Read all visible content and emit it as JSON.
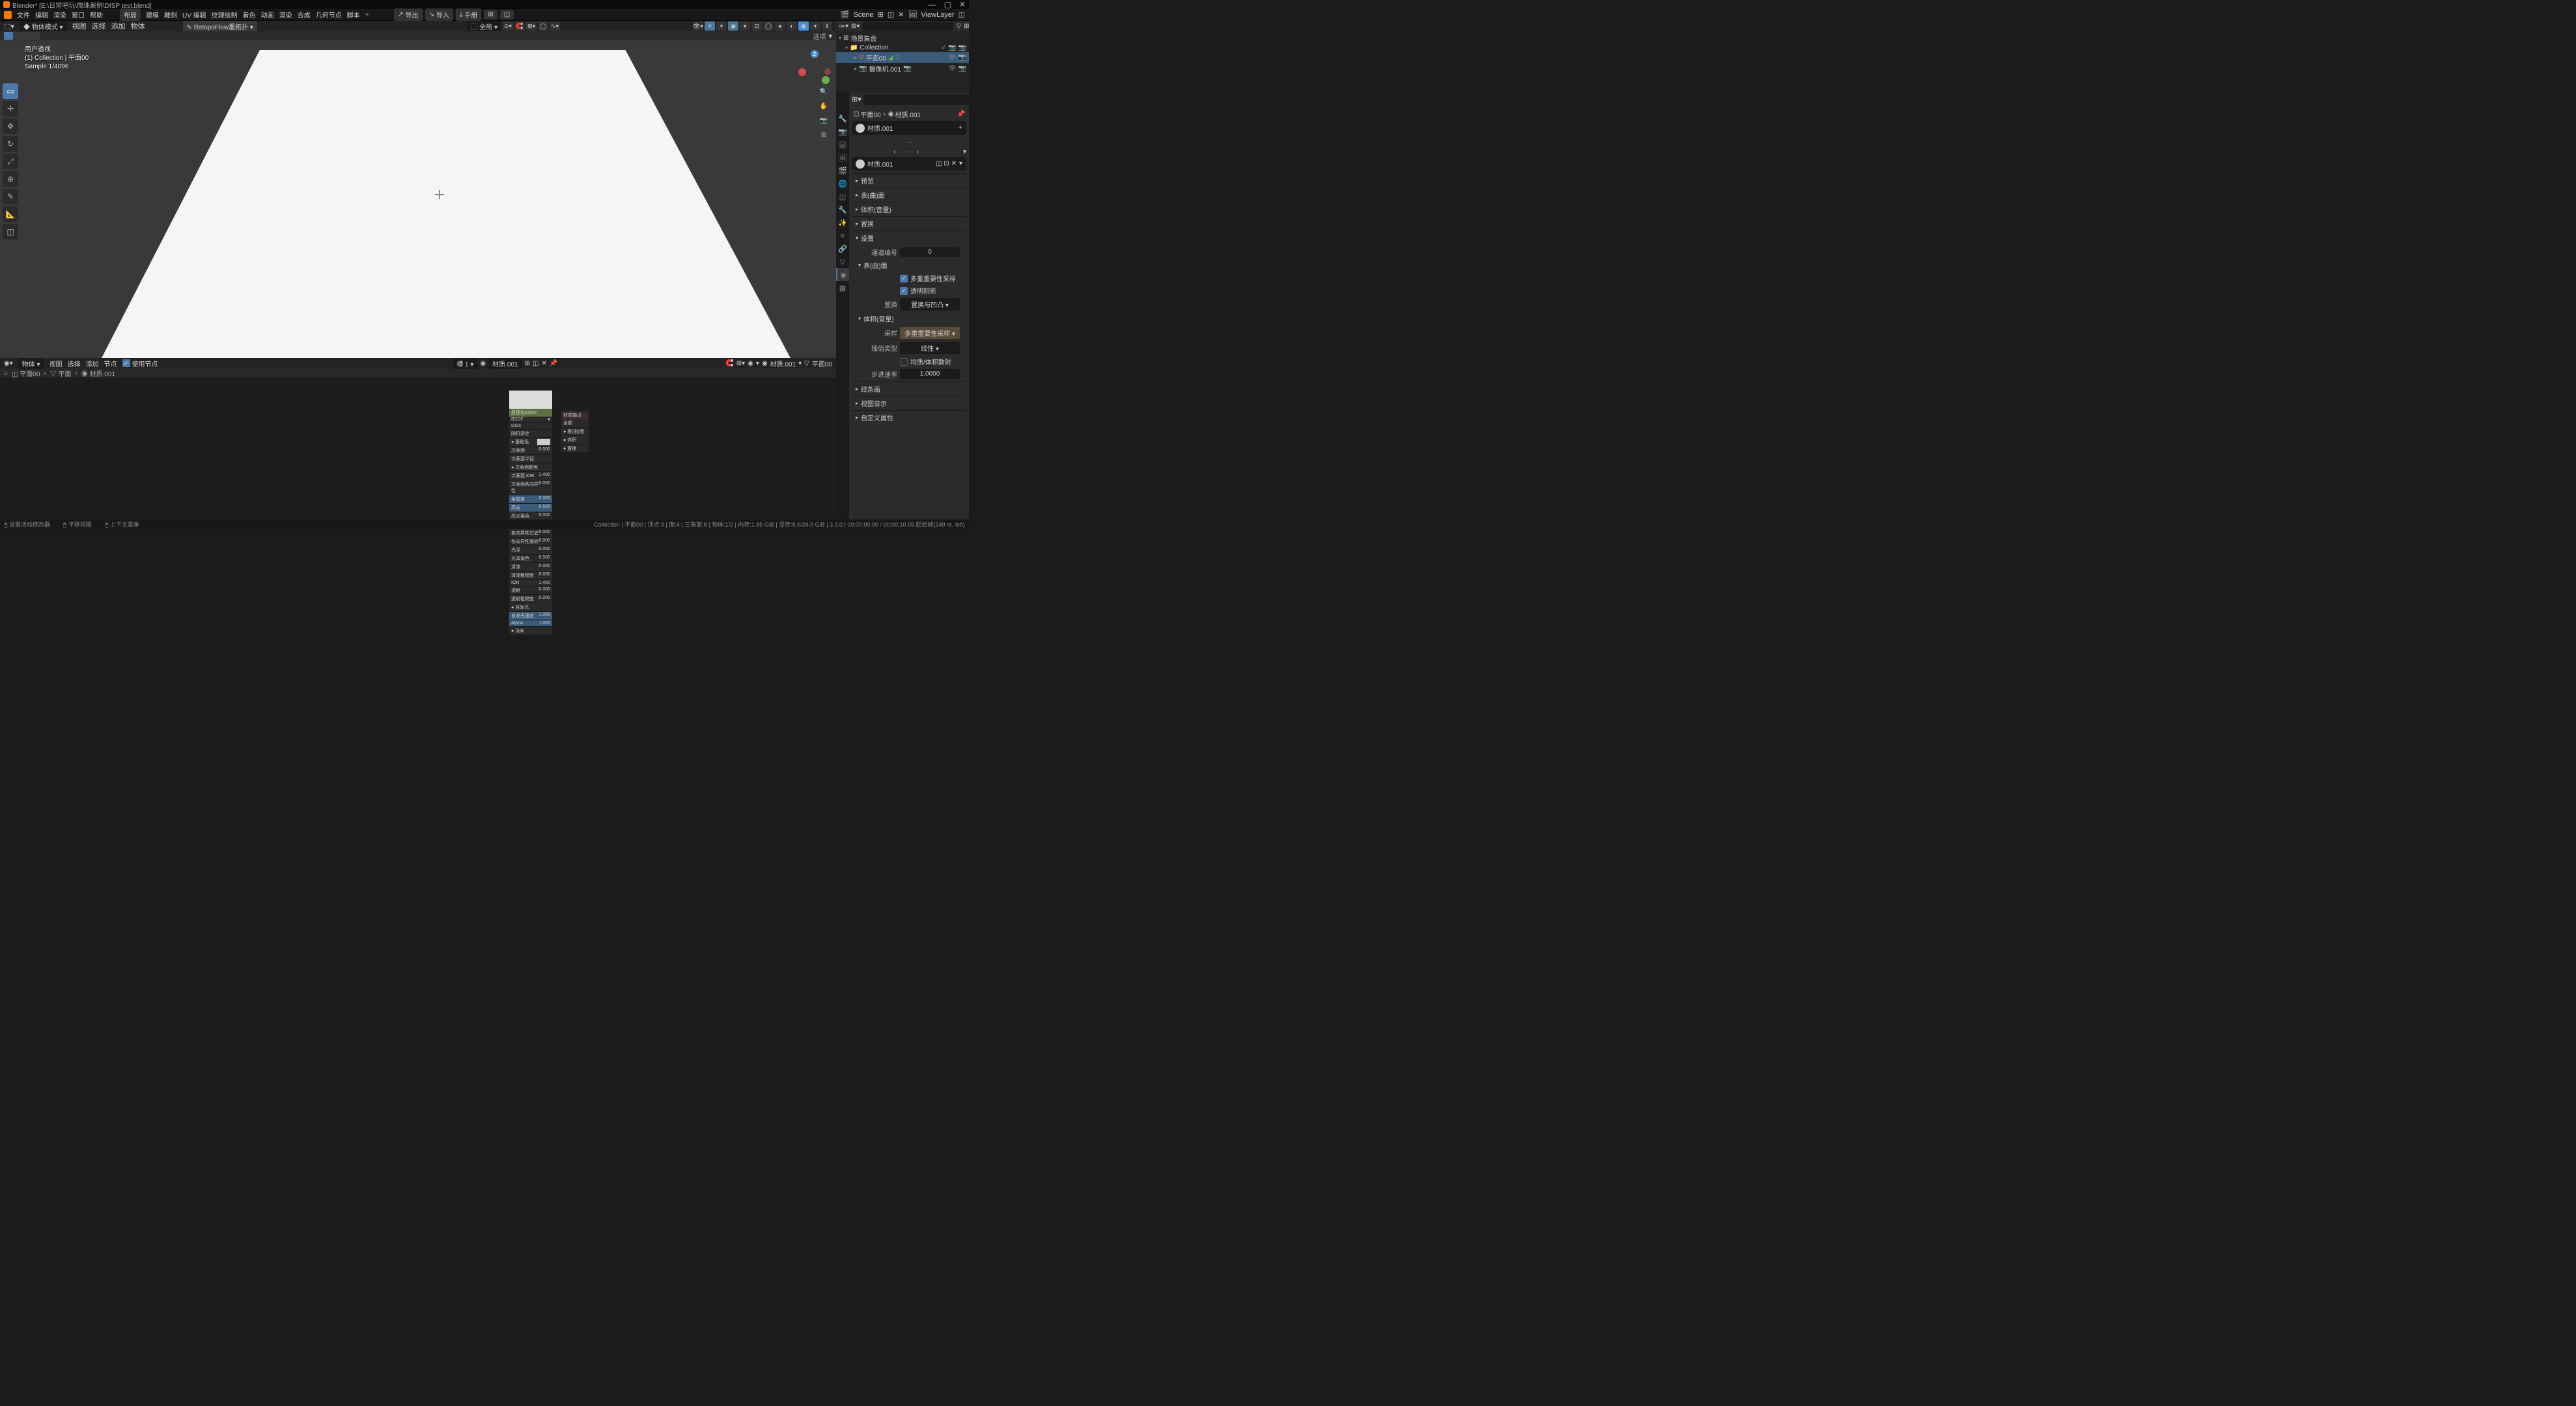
{
  "titlebar": {
    "title": "Blender* [E:\\日常吧玩\\微珠案例\\DISP test.blend]"
  },
  "menubar": {
    "items": [
      "文件",
      "编辑",
      "渲染",
      "窗口",
      "帮助"
    ],
    "tabs": [
      "布局",
      "建模",
      "雕刻",
      "UV 编辑",
      "纹理绘制",
      "着色",
      "动画",
      "渲染",
      "合成",
      "几何节点",
      "脚本"
    ],
    "active_tab": "布局",
    "center": {
      "export": "导出",
      "import": "导入",
      "manual": "手册"
    },
    "scene_label": "Scene",
    "viewlayer_label": "ViewLayer"
  },
  "toolbar2": {
    "mode": "物体模式",
    "menu": [
      "视图",
      "选择",
      "添加",
      "物体"
    ],
    "retopo": "RetopoFlow重拓扑",
    "global": "全局"
  },
  "toolbar3": {
    "options": "选项"
  },
  "viewport": {
    "info_line1": "用户透视",
    "info_line2": "(1) Collection | 平面00",
    "info_line3": "Sample 1/4096"
  },
  "outliner": {
    "header": "场景集合",
    "search_placeholder": "",
    "tree": [
      {
        "label": "Collection",
        "indent": 0,
        "icons": [
          "✓",
          "📷",
          "📷"
        ]
      },
      {
        "label": "平面00",
        "indent": 1,
        "selected": true,
        "icons": [
          "👁",
          "📷"
        ]
      },
      {
        "label": "摄像机.001",
        "indent": 1,
        "icons": [
          "👁",
          "📷"
        ]
      }
    ]
  },
  "properties": {
    "search_placeholder": "",
    "breadcrumb": {
      "obj": "平面00",
      "mat": "材质.001"
    },
    "material_name": "材质.001",
    "linked_mat": "材质.001",
    "sections": {
      "preview": "预览",
      "surface": "表(曲)面",
      "volume": "体积(音量)",
      "displacement": "置换",
      "settings": "设置",
      "pass_index_label": "通道编号",
      "pass_index_value": "0",
      "sub_surface": "表(曲)面",
      "multi_importance": "多重重要性采样",
      "transparent_shadows": "透明阴影",
      "displacement_label": "置换",
      "displacement_value": "置换与凹凸",
      "sub_volume": "体积(音量)",
      "sampling_label": "采样",
      "sampling_value": "多重重要性采样",
      "interp_label": "插值类型",
      "interp_value": "线性",
      "homogeneous": "均质/体积散射",
      "step_label": "步进速率",
      "step_value": "1.0000",
      "line_art": "线条画",
      "viewport_display": "视图显示",
      "custom_props": "自定义属性"
    }
  },
  "node_editor": {
    "header": {
      "mode": "物体",
      "menu": [
        "视图",
        "选择",
        "添加",
        "节点"
      ],
      "use_nodes": "使用节点",
      "slot": "槽 1",
      "material": "材质.001",
      "right_mat": "材质.001",
      "right_obj": "平面00"
    },
    "breadcrumb": [
      "平面00",
      "平面",
      "材质.001"
    ]
  },
  "statusbar": {
    "left": [
      "设置活动修改器",
      "平移视图",
      "上下文菜单"
    ],
    "right": "Collection | 平面00 | 顶点:9 | 面:4 | 三角面:8 | 物体:1/2 | 内存:1.85 GiB | 显存:8.6/24.0 GiB | 3.3.0 | 00:00:00.00 / 00:00:10.09 起始帧(249 re. left)"
  }
}
